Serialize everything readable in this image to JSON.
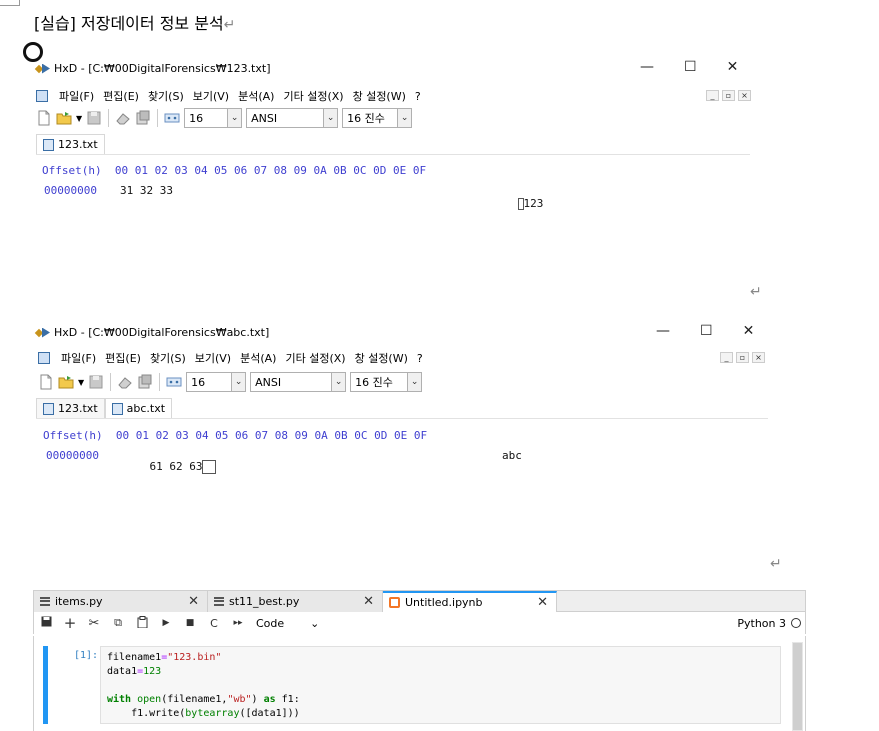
{
  "document": {
    "title": "[실습] 저장데이터 정보 분석",
    "return_mark": "↵"
  },
  "hxd_windows": [
    {
      "title": "HxD - [C:₩00DigitalForensics₩123.txt]",
      "window_controls": {
        "minimize": "—",
        "maximize": "☐",
        "close": "✕"
      },
      "menu": [
        "파일(F)",
        "편집(E)",
        "찾기(S)",
        "보기(V)",
        "분석(A)",
        "기타 설정(X)",
        "창 설정(W)",
        "?"
      ],
      "mdi_controls": [
        "_",
        "▫",
        "×"
      ],
      "toolbar": {
        "bytes_per_row": "16",
        "charset": "ANSI",
        "offset_base": "16 진수"
      },
      "tabs": [
        "123.txt"
      ],
      "hex_header": "Offset(h)  00 01 02 03 04 05 06 07 08 09 0A 0B 0C 0D 0E 0F",
      "rows": [
        {
          "offset": "00000000",
          "hex": "31 32 33",
          "text": "123"
        }
      ]
    },
    {
      "title": "HxD - [C:₩00DigitalForensics₩abc.txt]",
      "window_controls": {
        "minimize": "—",
        "maximize": "☐",
        "close": "✕"
      },
      "menu": [
        "파일(F)",
        "편집(E)",
        "찾기(S)",
        "보기(V)",
        "분석(A)",
        "기타 설정(X)",
        "창 설정(W)",
        "?"
      ],
      "mdi_controls": [
        "_",
        "▫",
        "×"
      ],
      "toolbar": {
        "bytes_per_row": "16",
        "charset": "ANSI",
        "offset_base": "16 진수"
      },
      "tabs": [
        "123.txt",
        "abc.txt"
      ],
      "hex_header": "Offset(h)  00 01 02 03 04 05 06 07 08 09 0A 0B 0C 0D 0E 0F",
      "rows": [
        {
          "offset": "00000000",
          "hex": "61 62 63",
          "text": "abc"
        }
      ]
    }
  ],
  "jupyter": {
    "tabs": [
      {
        "label": "items.py",
        "close": "✕"
      },
      {
        "label": "st11_best.py",
        "close": "✕"
      },
      {
        "label": "Untitled.ipynb",
        "close": "✕"
      }
    ],
    "toolbar": {
      "save": "💾",
      "add": "+",
      "cut": "✂",
      "copy": "⧉",
      "paste": "📋",
      "run": "▶",
      "stop": "■",
      "restart": "C",
      "run_all": "▸▸",
      "cell_type": "Code",
      "cell_type_arrow": "⌄",
      "kernel": "Python 3"
    },
    "cell": {
      "prompt": "[1]:",
      "lines": [
        "filename1=\"123.bin\"",
        "data1=123",
        "",
        "with open(filename1,\"wb\") as f1:",
        "    f1.write(bytearray([data1]))"
      ]
    }
  }
}
